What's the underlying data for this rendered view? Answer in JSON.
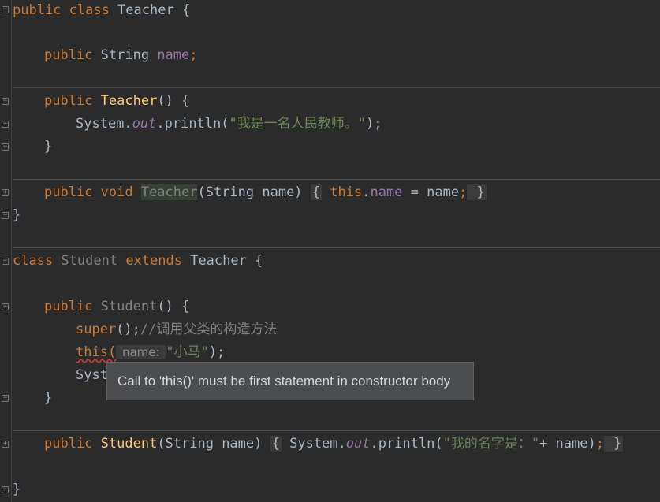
{
  "editor": {
    "lines": {
      "l1_kw": "public class ",
      "l1_name": "Teacher",
      "l1_brace": " {",
      "l2_kw": "public ",
      "l2_type": "String ",
      "l2_field": "name",
      "l2_semi": ";",
      "l3_kw": "public ",
      "l3_fn": "Teacher",
      "l3_rest": "() {",
      "l4_a": "System.",
      "l4_out": "out",
      "l4_b": ".println(",
      "l4_str": "\"我是一名人民教师。\"",
      "l4_c": ");",
      "l5_brace": "}",
      "l6_kw": "public void ",
      "l6_fn": "Teacher",
      "l6_params": "(String name) ",
      "l6_open": "{",
      "l6_this": " this",
      "l6_dot": ".",
      "l6_field": "name",
      "l6_assign": " = name",
      "l6_semi": ";",
      "l6_close": " }",
      "l7_brace": "}",
      "l8_kw": "class ",
      "l8_name": "Student",
      "l8_ext": " extends ",
      "l8_parent": "Teacher",
      "l8_brace": " {",
      "l9_kw": "public ",
      "l9_fn": "Student",
      "l9_rest": "() {",
      "l10_super": "super",
      "l10_rest": "();",
      "l10_cmt": "//调用父类的构造方法",
      "l11_this": "this(",
      "l11_hint": " name: ",
      "l11_str": "\"小马\"",
      "l11_rest": ");",
      "l12_a": "Syst",
      "l13_brace": "}",
      "l14_kw": "public ",
      "l14_fn": "Student",
      "l14_params": "(String name) ",
      "l14_open": "{",
      "l14_a": " System.",
      "l14_out": "out",
      "l14_b": ".println(",
      "l14_str": "\"我的名字是：\"",
      "l14_c": "+ name)",
      "l14_semi": ";",
      "l14_close": " }",
      "l15_brace": "}"
    },
    "tooltip": "Call to 'this()' must be first statement in constructor body"
  },
  "colors": {
    "background": "#2b2b2b",
    "keyword": "#cc7832",
    "string": "#6a8759",
    "field": "#9876aa",
    "method": "#ffc66d",
    "comment": "#808080",
    "error_underline": "#bc3f3c"
  },
  "icons": [
    "fold-collapse-icon",
    "fold-expand-icon"
  ]
}
